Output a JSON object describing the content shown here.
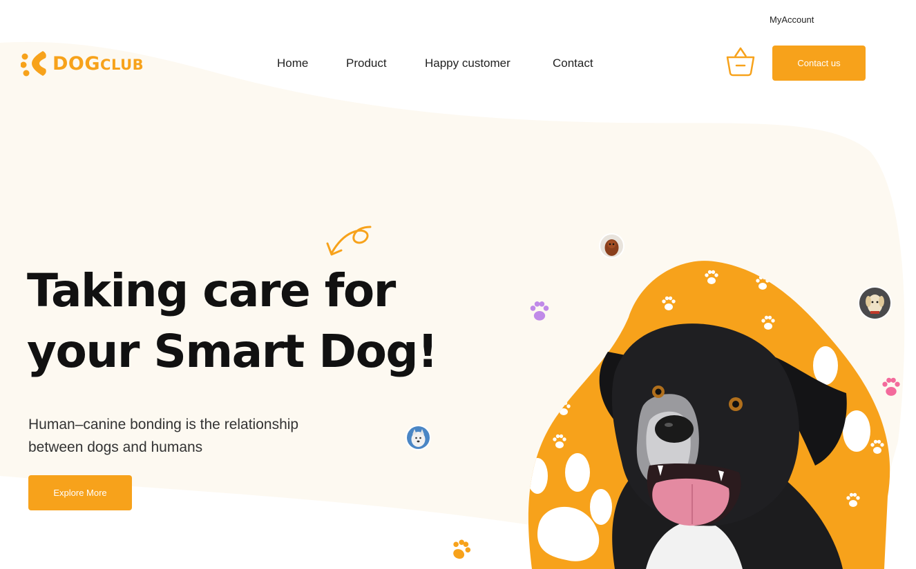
{
  "header": {
    "account_link": "MyAccount",
    "logo": {
      "word1": "DOG",
      "word2": "CLUB"
    },
    "nav": [
      {
        "label": "Home"
      },
      {
        "label": "Product"
      },
      {
        "label": "Happy customer"
      },
      {
        "label": "Contact"
      }
    ],
    "basket_icon": "basket-icon",
    "contact_button": "Contact us"
  },
  "hero": {
    "title_line1": "Taking care for",
    "title_line2": "your Smart Dog!",
    "subtitle": "Human–canine bonding is the relationship between dogs and humans",
    "cta": "Explore More"
  },
  "colors": {
    "accent": "#f7a21b",
    "background_wave": "#fdf9f1",
    "paw_purple": "#c08ae8",
    "paw_pink": "#f36a9c",
    "text": "#111111"
  },
  "icons": [
    "paw-icon",
    "arrow-doodle-icon",
    "basket-icon",
    "logo-paw-icon"
  ]
}
